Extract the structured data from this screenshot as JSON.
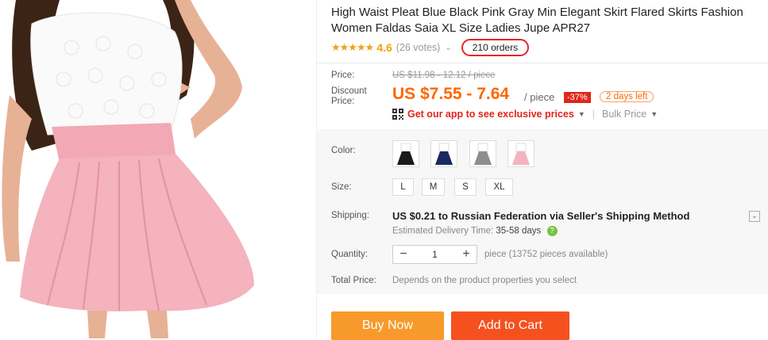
{
  "product": {
    "title": "High Waist Pleat Blue Black Pink Gray Min Elegant Skirt Flared Skirts Fashion Women Faldas Saia XL Size Ladies Jupe APR27",
    "stars": "★★★★★",
    "rating": "4.6",
    "votes": "(26 votes)",
    "orders": "210 orders"
  },
  "price": {
    "label": "Price:",
    "original": "US $11.98 - 12.12 / piece",
    "discount_label": "Discount Price:",
    "current": "US $7.55 - 7.64",
    "unit": "/ piece",
    "discount_pct": "-37%",
    "days_left": "2 days left",
    "app_promo": "Get our app to see exclusive prices",
    "bulk": "Bulk Price"
  },
  "options": {
    "color_label": "Color:",
    "colors": [
      "black",
      "blue",
      "gray",
      "pink"
    ],
    "swatch_colors": [
      "#1a1a1a",
      "#1b2a5e",
      "#8d8d8d",
      "#f4b3bd"
    ],
    "size_label": "Size:",
    "sizes": [
      "L",
      "M",
      "S",
      "XL"
    ]
  },
  "shipping": {
    "label": "Shipping:",
    "cost": "US $0.21",
    "destination": "to Russian Federation via Seller's Shipping Method",
    "est_label": "Estimated Delivery Time:",
    "est_value": "35-58 days"
  },
  "quantity": {
    "label": "Quantity:",
    "value": "1",
    "note": "piece (13752 pieces available)"
  },
  "total": {
    "label": "Total Price:",
    "value": "Depends on the product properties you select"
  },
  "actions": {
    "buy_now": "Buy Now",
    "add_to_cart": "Add to Cart"
  },
  "colors": {
    "accent": "#ff6600",
    "buy_now": "#f79a2b",
    "add_to_cart": "#f4511e",
    "skirt": "#f4b3bd",
    "lace_top": "#ffffff"
  }
}
